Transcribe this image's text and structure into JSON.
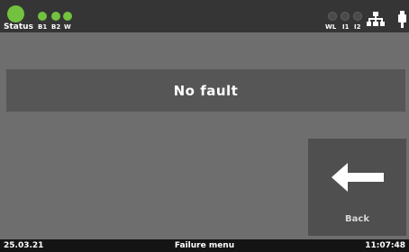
{
  "header": {
    "status_label": "Status",
    "indicators_left": [
      {
        "label": "B1",
        "state": "on"
      },
      {
        "label": "B2",
        "state": "on"
      },
      {
        "label": "W",
        "state": "on"
      }
    ],
    "indicators_right": [
      {
        "label": "WL",
        "state": "off"
      },
      {
        "label": "I1",
        "state": "off"
      },
      {
        "label": "I2",
        "state": "off"
      }
    ],
    "icons": [
      "network-icon",
      "usb-icon"
    ],
    "status_color": "#73c23f"
  },
  "main": {
    "message": "No fault"
  },
  "back_button": {
    "label": "Back",
    "icon": "arrow-left-icon"
  },
  "footer": {
    "date": "25.03.21",
    "title": "Failure menu",
    "time": "11:07:48"
  }
}
